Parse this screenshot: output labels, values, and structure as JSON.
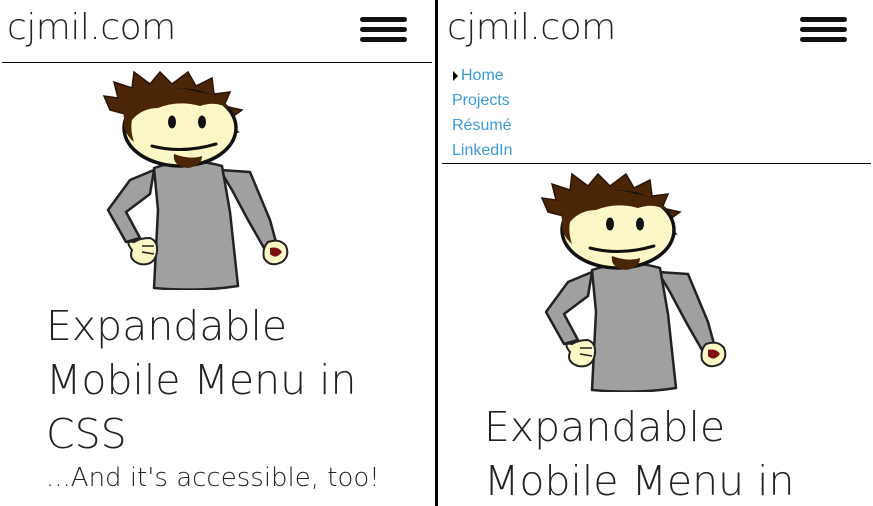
{
  "left": {
    "site_title": "cjmil.com",
    "heading": "Expandable Mobile Menu in CSS",
    "subheading": "...And it's accessible, too!"
  },
  "right": {
    "site_title": "cjmil.com",
    "nav": [
      {
        "label": "Home",
        "active": true
      },
      {
        "label": "Projects",
        "active": false
      },
      {
        "label": "Résumé",
        "active": false
      },
      {
        "label": "LinkedIn",
        "active": false
      }
    ],
    "heading": "Expandable Mobile Menu in"
  },
  "icons": {
    "menu": "hamburger-menu-icon",
    "active_marker": "triangle-right-icon"
  },
  "colors": {
    "link": "#3a9ad9",
    "text": "#222222",
    "shirt": "#a0a0a0",
    "skin": "#fbf7c7",
    "hair": "#4a2606"
  }
}
